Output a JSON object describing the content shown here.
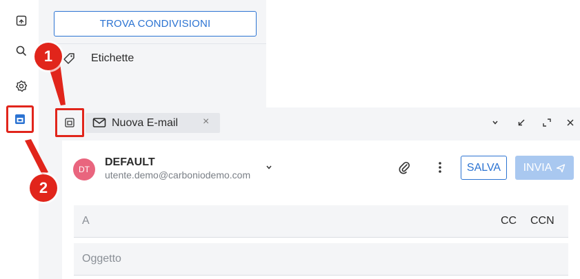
{
  "sidebar": {
    "find_shares_label": "TROVA CONDIVISIONI",
    "tags_label": "Etichette"
  },
  "rail": {
    "icons": [
      "folder-icon",
      "search-icon",
      "settings-icon",
      "board-icon"
    ]
  },
  "composer": {
    "tab_title": "Nuova E-mail",
    "tab_close": "×",
    "window_controls": [
      "chevron-down-icon",
      "minimize-icon",
      "expand-icon",
      "close-icon"
    ],
    "sender": {
      "initials": "DT",
      "name": "DEFAULT",
      "email": "utente.demo@carboniodemo.com"
    },
    "save_label": "SALVA",
    "send_label": "INVIA",
    "to_label": "A",
    "cc_label": "CC",
    "ccn_label": "CCN",
    "subject_label": "Oggetto"
  },
  "callouts": [
    "1",
    "2"
  ],
  "colors": {
    "accent": "#2b73d2",
    "highlight": "#e1251b",
    "avatar": "#e9657e",
    "send_disabled": "#a9c8f0"
  }
}
